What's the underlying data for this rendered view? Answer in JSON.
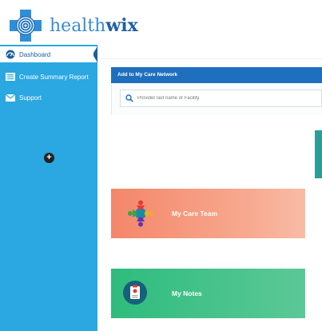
{
  "brand": {
    "part1": "health",
    "part2": "wix"
  },
  "sidebar": {
    "items": [
      {
        "label": "Dashboard",
        "icon": "dashboard-gauge-icon"
      },
      {
        "label": "Create Summary Report",
        "icon": "report-icon"
      },
      {
        "label": "Support",
        "icon": "envelope-icon"
      }
    ],
    "add_symbol": "+"
  },
  "care_network": {
    "title": "Add to My Care Network",
    "search_placeholder": "Provider last name or Facility"
  },
  "cards": {
    "team_label": "My Care Team",
    "notes_label": "My Notes"
  },
  "colors": {
    "sidebar": "#2ba7e2",
    "panel_header": "#1f6fbf",
    "team_card": "#f4866a",
    "notes_card": "#2ebc7d",
    "accent_teal": "#2a9e97"
  }
}
